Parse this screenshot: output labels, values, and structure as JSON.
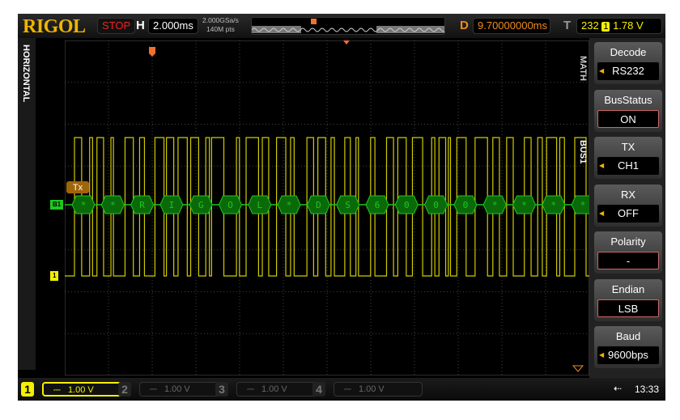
{
  "brand": "RIGOL",
  "header": {
    "run_state": "STOP",
    "h_label": "H",
    "timebase": "2.000ms",
    "sample_rate": "2.000GSa/s",
    "memory_depth": "140M pts",
    "d_label": "D",
    "delay": "9.70000000ms",
    "t_label": "T",
    "trigger_count": "232",
    "trigger_source": "1",
    "trigger_level": "1.78 V"
  },
  "left_panel": {
    "title": "HORIZONTAL"
  },
  "waveform": {
    "bus_label": "B1",
    "channel_label": "1",
    "bus_name": "Tx",
    "decoded": [
      "*",
      "*",
      "R",
      "I",
      "G",
      "O",
      "L",
      "*",
      "D",
      "S",
      "6",
      "0",
      "0",
      "0",
      "*",
      "*",
      "*",
      "*"
    ],
    "colors": {
      "ch1": "#f5f000",
      "bus": "#1ec81e",
      "bus_fill": "#0a6a0a"
    }
  },
  "menu": {
    "tab_math": "MATH",
    "tab_bus": "BUS1",
    "items": [
      {
        "title": "Decode",
        "value": "RS232",
        "style": "arrow"
      },
      {
        "title": "BusStatus",
        "value": "ON",
        "style": "boxed"
      },
      {
        "title": "TX",
        "value": "CH1",
        "style": "arrow"
      },
      {
        "title": "RX",
        "value": "OFF",
        "style": "arrow"
      },
      {
        "title": "Polarity",
        "value": "-",
        "style": "boxed"
      },
      {
        "title": "Endian",
        "value": "LSB",
        "style": "boxed"
      },
      {
        "title": "Baud",
        "value": "9600bps",
        "style": "arrow"
      }
    ]
  },
  "footer": {
    "channels": [
      {
        "num": "1",
        "scale": "1.00 V",
        "active": true
      },
      {
        "num": "2",
        "scale": "1.00 V"
      },
      {
        "num": "3",
        "scale": "1.00 V"
      },
      {
        "num": "4",
        "scale": "1.00 V"
      }
    ],
    "coupling_icon": "dc-coupling-icon",
    "usb_icon": "usb-icon",
    "time": "13:33"
  }
}
